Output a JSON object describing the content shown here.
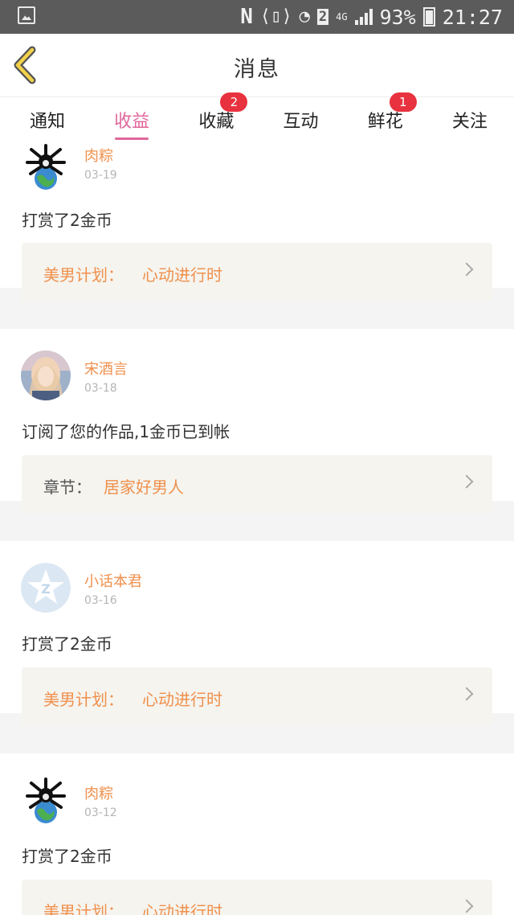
{
  "status_bar": {
    "battery": "93%",
    "time": "21:27",
    "sim": "2",
    "network": "4G"
  },
  "header": {
    "title": "消息"
  },
  "tabs": [
    {
      "label": "通知",
      "badge": ""
    },
    {
      "label": "收益",
      "badge": "",
      "active": true
    },
    {
      "label": "收藏",
      "badge": "2"
    },
    {
      "label": "互动",
      "badge": ""
    },
    {
      "label": "鲜花",
      "badge": "1"
    },
    {
      "label": "关注",
      "badge": ""
    }
  ],
  "items": [
    {
      "user": "肉粽",
      "date": "03-19",
      "message": "打赏了2金币",
      "related_label": "美男计划：",
      "related_title": "心动进行时"
    },
    {
      "user": "宋酒言",
      "date": "03-18",
      "message": "订阅了您的作品,1金币已到帐",
      "related_label": "章节：",
      "related_title": "居家好男人"
    },
    {
      "user": "小话本君",
      "date": "03-16",
      "message": "打赏了2金币",
      "related_label": "美男计划：",
      "related_title": "心动进行时"
    },
    {
      "user": "肉粽",
      "date": "03-12",
      "message": "打赏了2金币",
      "related_label": "美男计划：",
      "related_title": "心动进行时"
    }
  ]
}
